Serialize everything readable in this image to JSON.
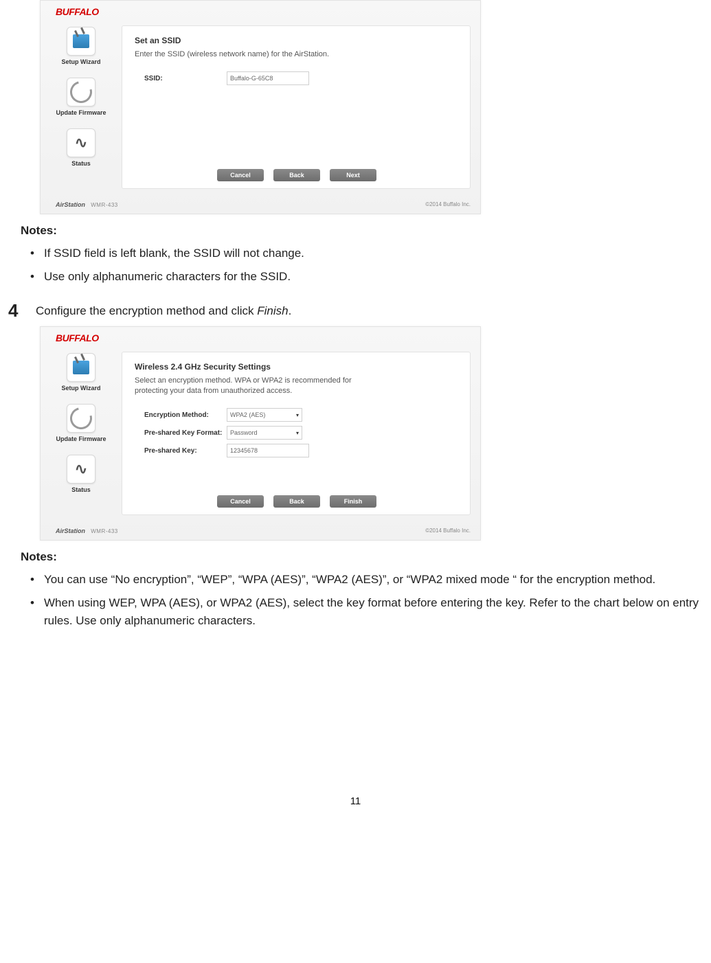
{
  "page_number": "11",
  "screenshot1": {
    "brand": "BUFFALO",
    "sidebar": {
      "setup_wizard": "Setup Wizard",
      "update_firmware": "Update Firmware",
      "status": "Status"
    },
    "panel": {
      "title": "Set an SSID",
      "desc": "Enter the SSID (wireless network name) for the AirStation.",
      "ssid_label": "SSID:",
      "ssid_value": "Buffalo-G-65C8"
    },
    "buttons": {
      "cancel": "Cancel",
      "back": "Back",
      "next": "Next"
    },
    "footer": {
      "product": "AirStation",
      "model": "WMR-433",
      "copyright": "©2014 Buffalo Inc."
    }
  },
  "notes1": {
    "heading": "Notes:",
    "items": [
      "If SSID field is left blank, the SSID will not change.",
      "Use only alphanumeric characters for the SSID."
    ]
  },
  "step4": {
    "number": "4",
    "text_pre": "Configure the encryption method and click ",
    "text_finish": "Finish",
    "text_post": "."
  },
  "screenshot2": {
    "brand": "BUFFALO",
    "sidebar": {
      "setup_wizard": "Setup Wizard",
      "update_firmware": "Update Firmware",
      "status": "Status"
    },
    "panel": {
      "title": "Wireless 2.4 GHz Security Settings",
      "desc": "Select an encryption method. WPA or WPA2 is recommended for protecting your data from unauthorized access.",
      "enc_label": "Encryption Method:",
      "enc_value": "WPA2 (AES)",
      "fmt_label": "Pre-shared Key Format:",
      "fmt_value": "Password",
      "key_label": "Pre-shared Key:",
      "key_value": "12345678"
    },
    "buttons": {
      "cancel": "Cancel",
      "back": "Back",
      "finish": "Finish"
    },
    "footer": {
      "product": "AirStation",
      "model": "WMR-433",
      "copyright": "©2014 Buffalo Inc."
    }
  },
  "notes2": {
    "heading": "Notes:",
    "items": [
      "You can use “No encryption”, “WEP”, “WPA (AES)”, “WPA2 (AES)”, or “WPA2 mixed mode “ for the encryption method.",
      "When using WEP, WPA (AES), or WPA2 (AES), select the key format before entering the key. Refer to the chart below on entry rules. Use only alphanumeric characters."
    ]
  }
}
